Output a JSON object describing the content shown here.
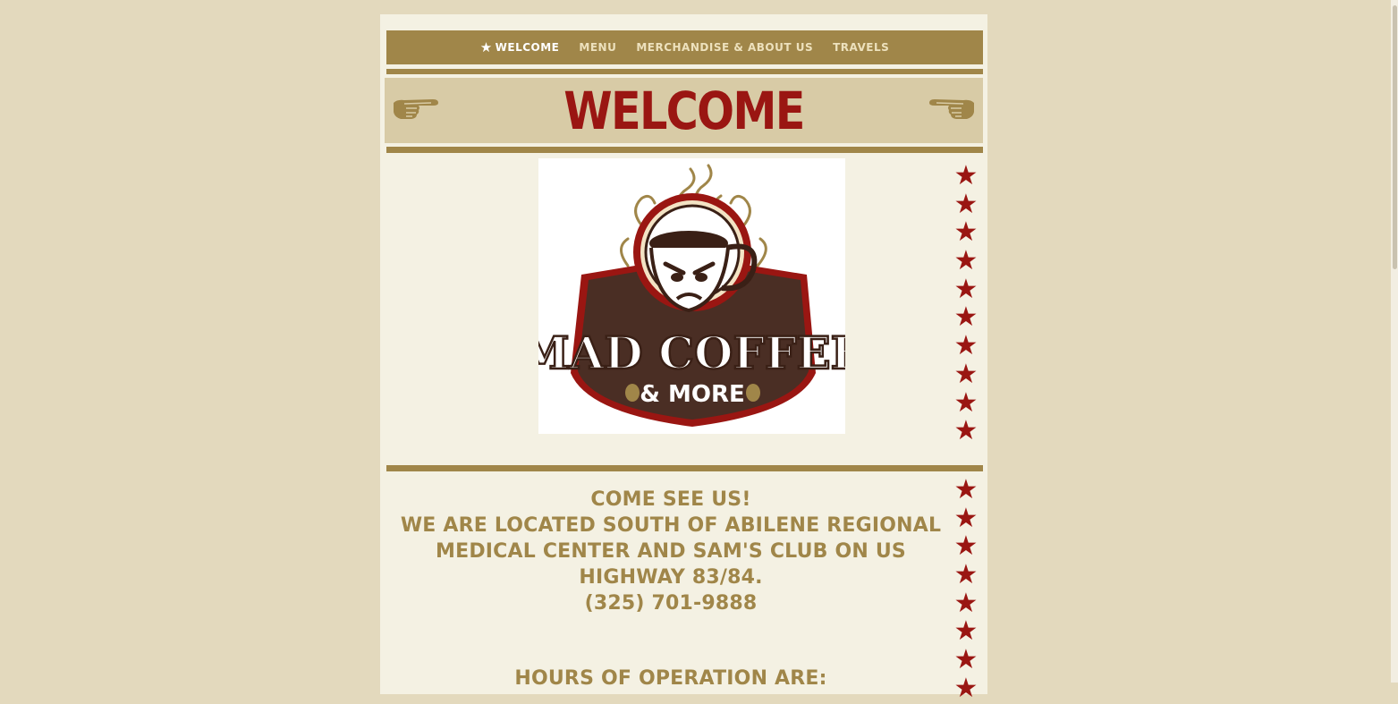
{
  "nav": {
    "items": [
      {
        "label": "WELCOME",
        "active": true,
        "icon": "star-icon"
      },
      {
        "label": "MENU",
        "active": false
      },
      {
        "label": "MERCHANDISE & ABOUT US",
        "active": false
      },
      {
        "label": "TRAVELS",
        "active": false
      }
    ]
  },
  "banner": {
    "title": "WELCOME",
    "left_icon": "pointing-hand-right-icon",
    "right_icon": "pointing-hand-left-icon"
  },
  "logo": {
    "name": "MAD COFFEE",
    "tagline": "& MORE"
  },
  "info": {
    "line1": "COME SEE US!",
    "line2": "WE ARE LOCATED SOUTH OF ABILENE REGIONAL MEDICAL CENTER AND SAM'S CLUB ON US HIGHWAY 83/84.",
    "phone": "(325) 701-9888",
    "hours_heading": "HOURS OF OPERATION ARE:"
  },
  "colors": {
    "background": "#e3d9bd",
    "page": "#f4f1e3",
    "accent_tan": "#a08649",
    "banner_bg": "#d8cba6",
    "title_red": "#9a1612",
    "star_red": "#9a1612"
  }
}
